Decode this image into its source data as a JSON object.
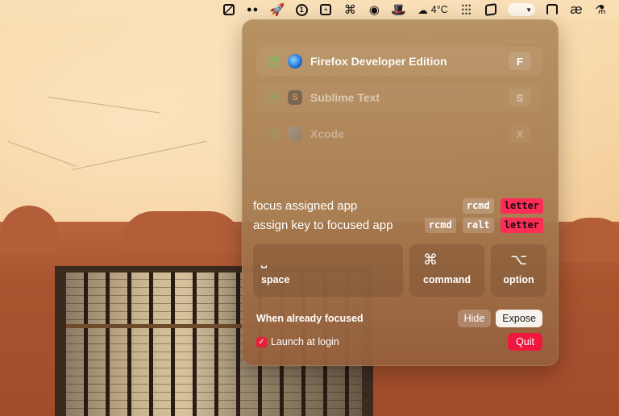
{
  "menubar": {
    "weather_icon": "cloud-snow-icon",
    "weather_temp": "4°C",
    "toggle_glyph": "▼"
  },
  "apps": [
    {
      "name": "Firefox Developer Edition",
      "key": "F",
      "state": "active"
    },
    {
      "name": "Sublime Text",
      "key": "S",
      "state": "dim"
    },
    {
      "name": "Xcode",
      "key": "X",
      "state": "dimmer"
    }
  ],
  "hints": {
    "focus": {
      "text": "focus assigned app",
      "keys": [
        "rcmd",
        "letter"
      ]
    },
    "assign": {
      "text": "assign key to focused app",
      "keys": [
        "rcmd",
        "ralt",
        "letter"
      ]
    }
  },
  "modifiers": {
    "space": {
      "glyph": "⎵",
      "label": "space"
    },
    "command": {
      "glyph": "⌘",
      "label": "command"
    },
    "option": {
      "glyph": "⌥",
      "label": "option"
    }
  },
  "focused": {
    "label": "When already focused",
    "hide_label": "Hide",
    "expose_label": "Expose",
    "selected": "Expose"
  },
  "login": {
    "label": "Launch at login",
    "checked": true,
    "quit_label": "Quit"
  },
  "colors": {
    "accent": "#ff2d55",
    "quit": "#f0173f",
    "plus": "#5bd05b"
  }
}
